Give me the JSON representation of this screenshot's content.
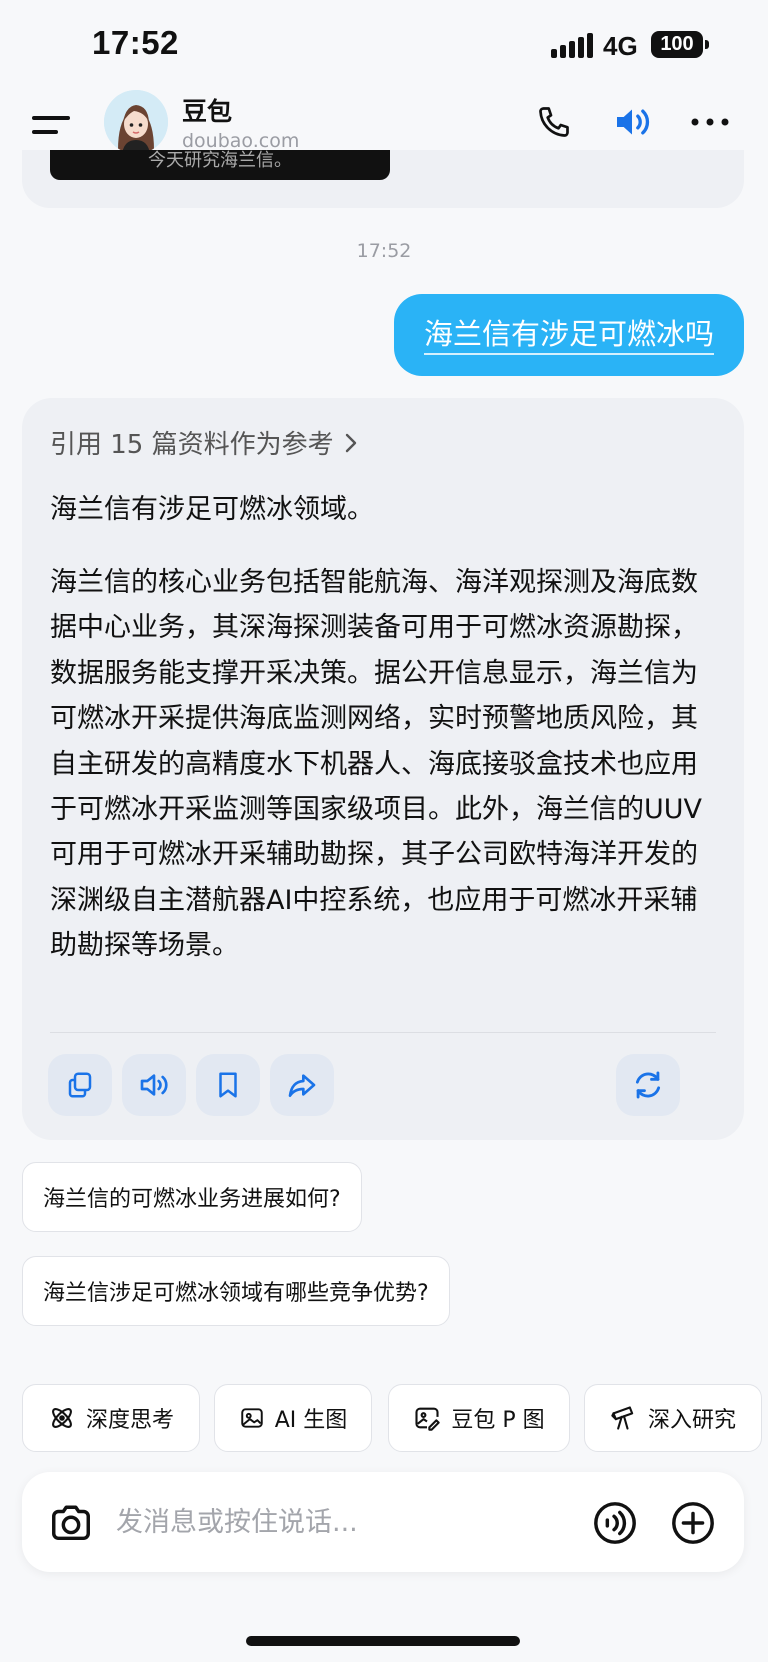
{
  "status_bar": {
    "time": "17:52",
    "network": "4G",
    "battery": "100"
  },
  "header": {
    "bot_name": "豆包",
    "bot_domain": "doubao.com",
    "icons": [
      "menu-icon",
      "phone-icon",
      "speaker-icon",
      "more-icon"
    ],
    "accent": "#1a73e8"
  },
  "conversation": {
    "previous_caption": "今天研究海兰信。",
    "timestamp": "17:52",
    "user_message": "海兰信有涉足可燃冰吗",
    "answer": {
      "reference_line": "引用 15 篇资料作为参考",
      "paragraph_1": "海兰信有涉足可燃冰领域。",
      "paragraph_2": "海兰信的核心业务包括智能航海、海洋观探测及海底数据中心业务，其深海探测装备可用于可燃冰资源勘探，数据服务能支撑开采决策。据公开信息显示，海兰信为可燃冰开采提供海底监测网络，实时预警地质风险，其自主研发的高精度水下机器人、海底接驳盒技术也应用于可燃冰开采监测等国家级项目。此外，海兰信的UUV可用于可燃冰开采辅助勘探，其子公司欧特海洋开发的深渊级自主潜航器AI中控系统，也应用于可燃冰开采辅助勘探等场景。",
      "actions": [
        "copy-icon",
        "read-aloud-icon",
        "bookmark-icon",
        "share-icon",
        "regenerate-icon"
      ]
    },
    "suggestions": [
      "海兰信的可燃冰业务进展如何?",
      "海兰信涉足可燃冰领域有哪些竞争优势?"
    ]
  },
  "skills": [
    {
      "label": "深度思考",
      "icon": "atom-icon"
    },
    {
      "label": "AI 生图",
      "icon": "image-icon"
    },
    {
      "label": "豆包 P 图",
      "icon": "photo-edit-icon"
    },
    {
      "label": "深入研究",
      "icon": "telescope-icon"
    }
  ],
  "composer": {
    "placeholder": "发消息或按住说话..."
  },
  "colors": {
    "user_bubble": "#2ab3f6",
    "background": "#f7f8fa",
    "card": "#eef0f4"
  }
}
